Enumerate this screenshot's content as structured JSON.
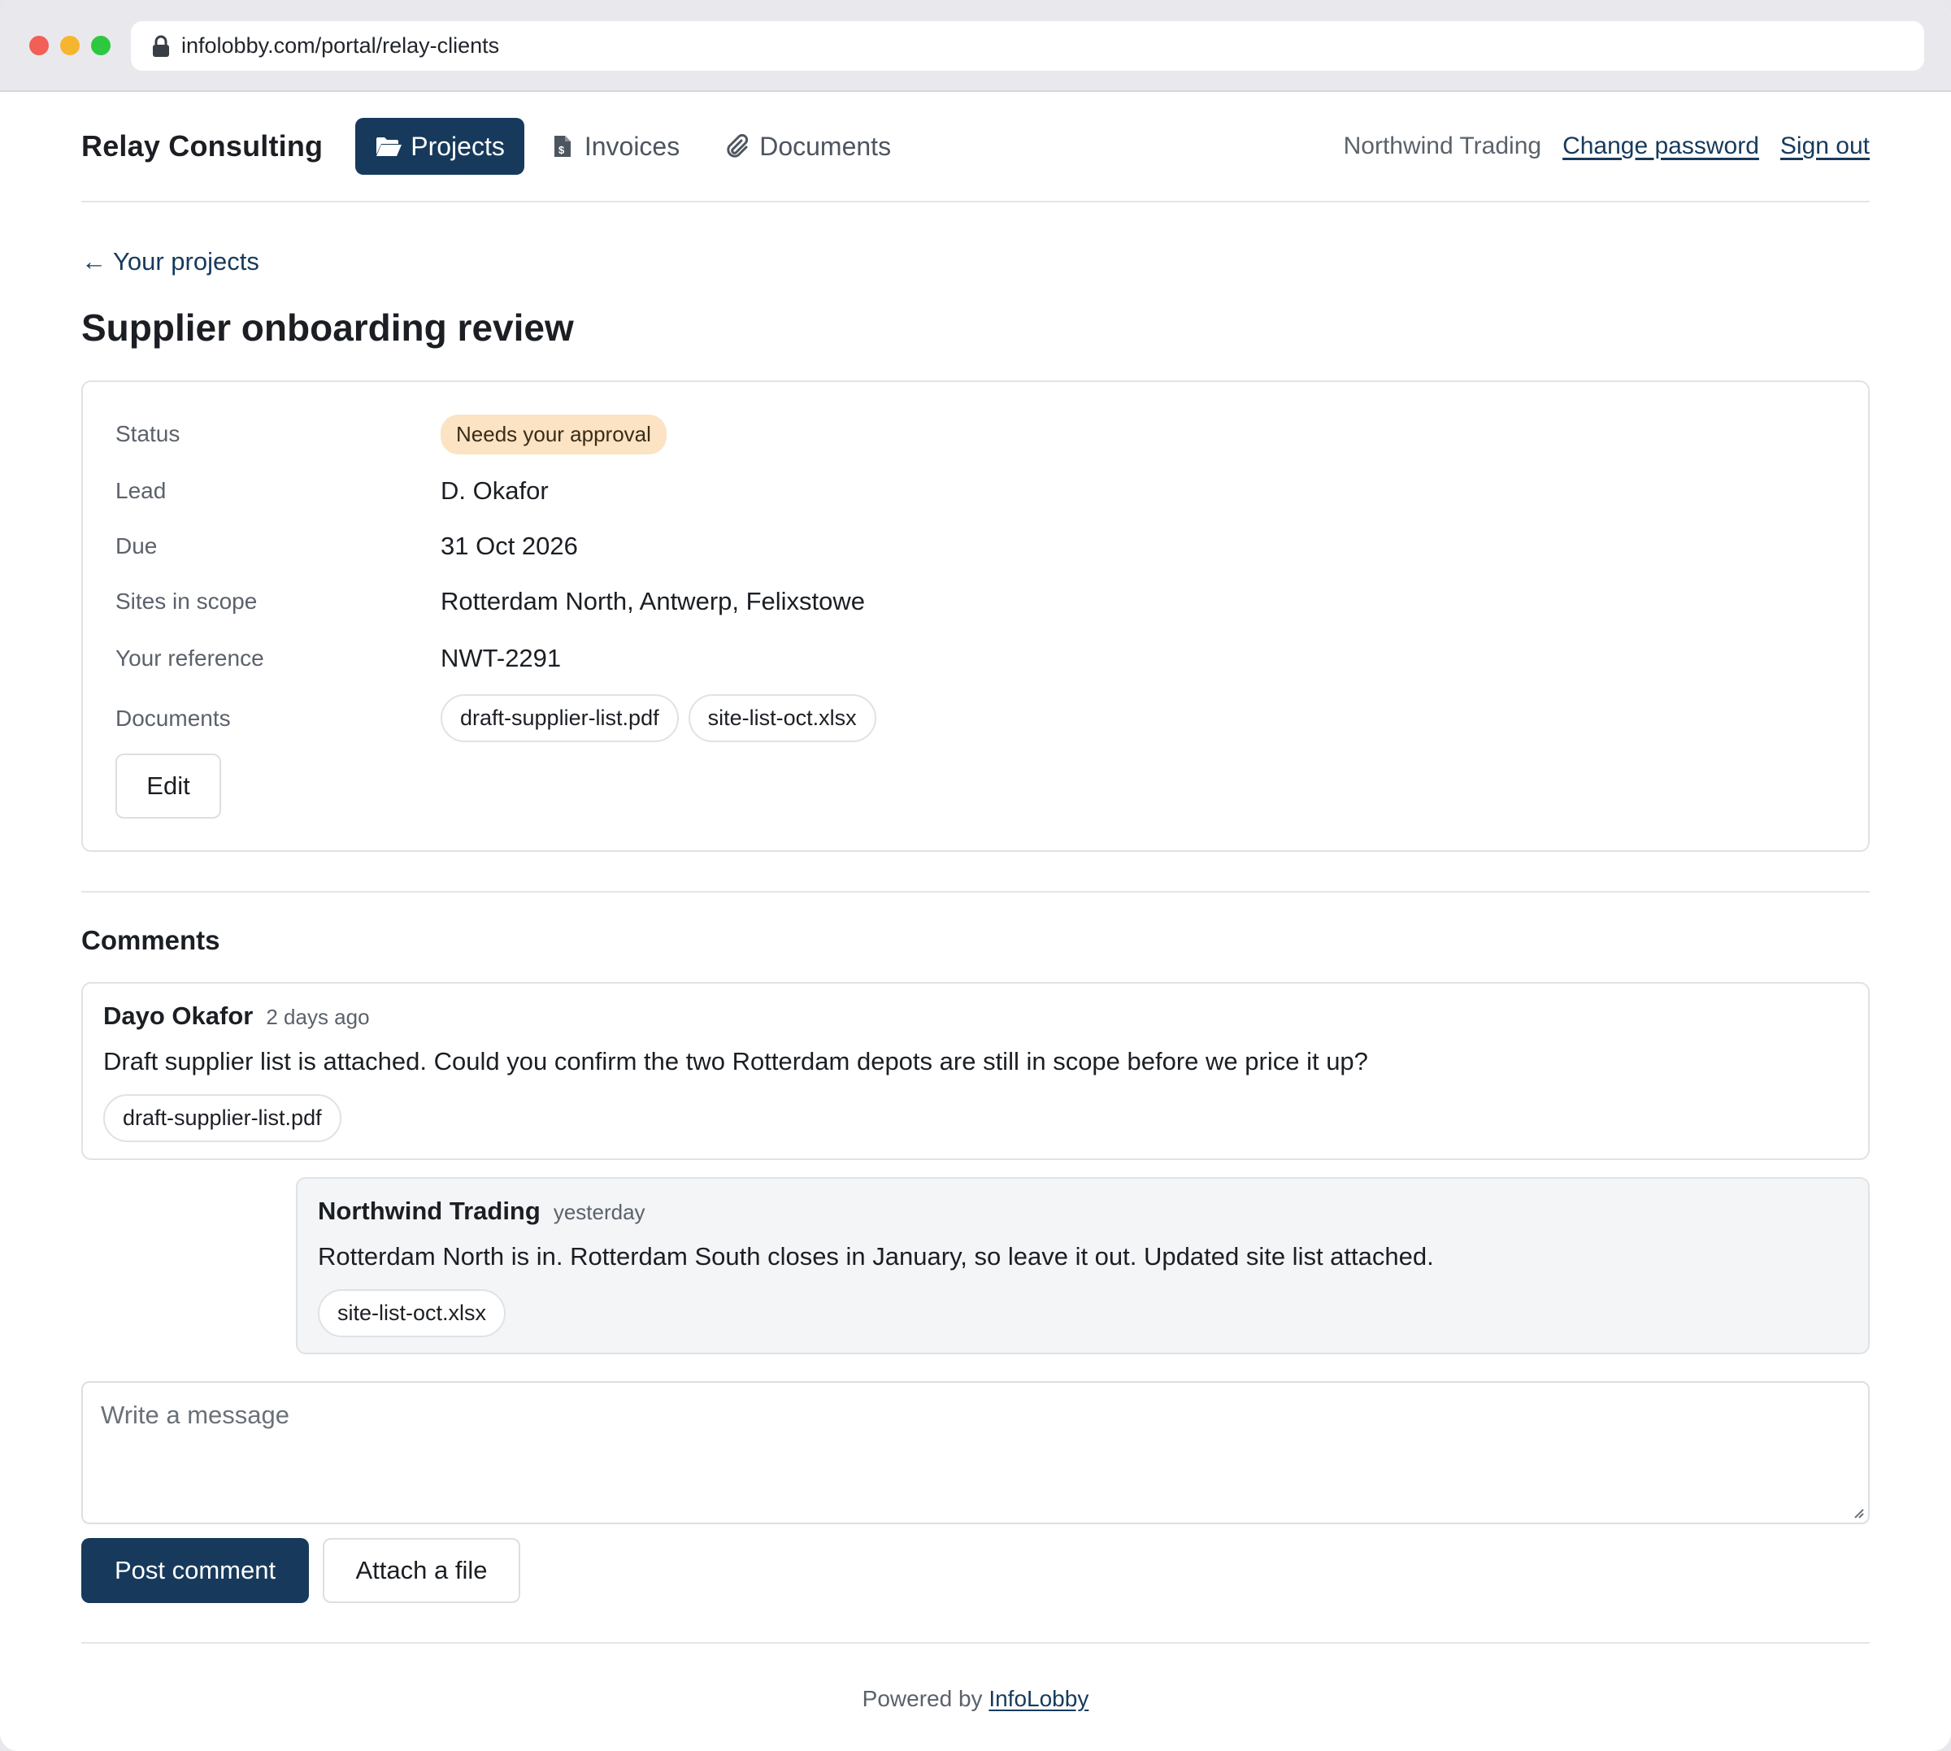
{
  "browser": {
    "url": "infolobby.com/portal/relay-clients",
    "lock_icon": "lock-icon"
  },
  "header": {
    "brand": "Relay Consulting",
    "nav": [
      {
        "label": "Projects",
        "icon": "folder-open-icon",
        "active": true
      },
      {
        "label": "Invoices",
        "icon": "invoice-icon",
        "active": false
      },
      {
        "label": "Documents",
        "icon": "paperclip-icon",
        "active": false
      }
    ],
    "client_name": "Northwind Trading",
    "change_password": "Change password",
    "sign_out": "Sign out"
  },
  "back_link": "← Your projects",
  "project": {
    "title": "Supplier onboarding review",
    "fields": {
      "status_label": "Status",
      "status_value": "Needs your approval",
      "lead_label": "Lead",
      "lead_value": "D. Okafor",
      "due_label": "Due",
      "due_value": "31 Oct 2026",
      "sites_label": "Sites in scope",
      "sites_value": "Rotterdam North, Antwerp, Felixstowe",
      "reference_label": "Your reference",
      "reference_value": "NWT-2291",
      "documents_label": "Documents",
      "documents": [
        "draft-supplier-list.pdf",
        "site-list-oct.xlsx"
      ]
    },
    "edit_label": "Edit"
  },
  "comments": {
    "heading": "Comments",
    "items": [
      {
        "author": "Dayo Okafor",
        "time": "2 days ago",
        "body": "Draft supplier list is attached. Could you confirm the two Rotterdam depots are still in scope before we price it up?",
        "attachment": "draft-supplier-list.pdf"
      },
      {
        "author": "Northwind Trading",
        "time": "yesterday",
        "body": "Rotterdam North is in. Rotterdam South closes in January, so leave it out. Updated site list attached.",
        "attachment": "site-list-oct.xlsx"
      }
    ],
    "placeholder": "Write a message",
    "post_label": "Post comment",
    "attach_label": "Attach a file"
  },
  "footer": {
    "prefix": "Powered by",
    "link": "InfoLobby"
  },
  "colors": {
    "accent": "#173a5c",
    "badge_bg": "#fbe3c4",
    "reply_bg": "#f4f5f7"
  }
}
